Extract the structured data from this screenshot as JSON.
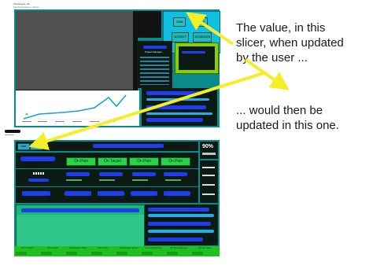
{
  "top_report": {
    "header_line1": "Timesheets, All",
    "header_line2": "Selected Employees, Various",
    "year_slicer": [
      "2088",
      "2089"
    ],
    "date_range": [
      "1/1/2017",
      "12/30/2018"
    ],
    "right_panel_title": "Project Manager"
  },
  "bottom_report": {
    "percent_value": "90%",
    "green_buttons": [
      "On Plan",
      "On Target",
      "On Plan",
      "On Plan"
    ],
    "footer_labels": [
      "Dev, cost plan",
      "Dev, actual",
      "Development, Hours",
      "Hours, Plan",
      "Development, actual",
      "Cost, Monthly Plan",
      "DB, Dev actual cost",
      "All Time, Sales"
    ]
  },
  "annotations": {
    "caption_top": "The value, in this slicer, when updated by the user ...",
    "caption_bottom": "... would then be updated in this one."
  },
  "colors": {
    "arrow": "#f3ee25",
    "dashboard_bg": "#0a8a8a",
    "panel_dark": "#0b1a12",
    "slicer_teal": "#1ea0a0",
    "redaction": "#1e3cf0"
  }
}
